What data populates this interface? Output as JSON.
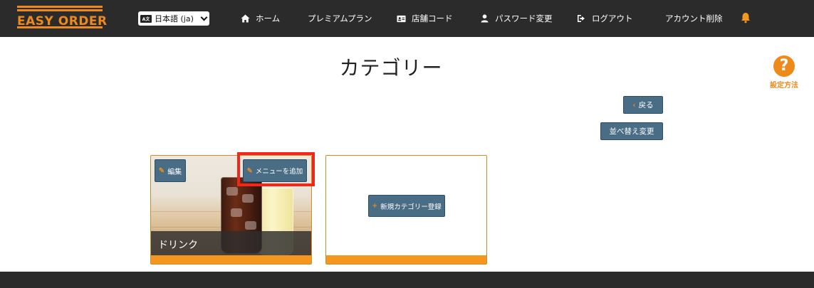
{
  "brand": {
    "logo_text": "EASY ORDER",
    "accent_color": "#ee8a1c"
  },
  "header": {
    "language": {
      "icon": "language-icon",
      "selected": "日本語 (ja)"
    },
    "nav": [
      {
        "icon": "home-icon",
        "label": "ホーム"
      },
      {
        "icon": "",
        "label": "プレミアムプラン"
      },
      {
        "icon": "id-card-icon",
        "label": "店舗コード"
      },
      {
        "icon": "user-icon",
        "label": "パスワード変更"
      },
      {
        "icon": "logout-icon",
        "label": "ログアウト"
      },
      {
        "icon": "",
        "label": "アカウント削除"
      }
    ],
    "notification_icon": "bell-icon"
  },
  "page": {
    "title": "カテゴリー",
    "help": {
      "icon": "question-circle-icon",
      "label": "設定方法"
    },
    "back_button": {
      "icon": "chevron-left-icon",
      "label": "戻る"
    },
    "sort_button": {
      "label": "並べ替え変更"
    }
  },
  "categories": [
    {
      "name": "ドリンク",
      "edit_label": "編集",
      "add_menu_label": "メニューを追加",
      "image": "drinks-photo"
    }
  ],
  "new_category": {
    "icon": "plus-icon",
    "label": "新規カテゴリー登録"
  },
  "colors": {
    "navbar": "#2b2b2b",
    "button": "#4a6d86",
    "card_footer": "#f5961e",
    "highlight": "#f0281c"
  }
}
